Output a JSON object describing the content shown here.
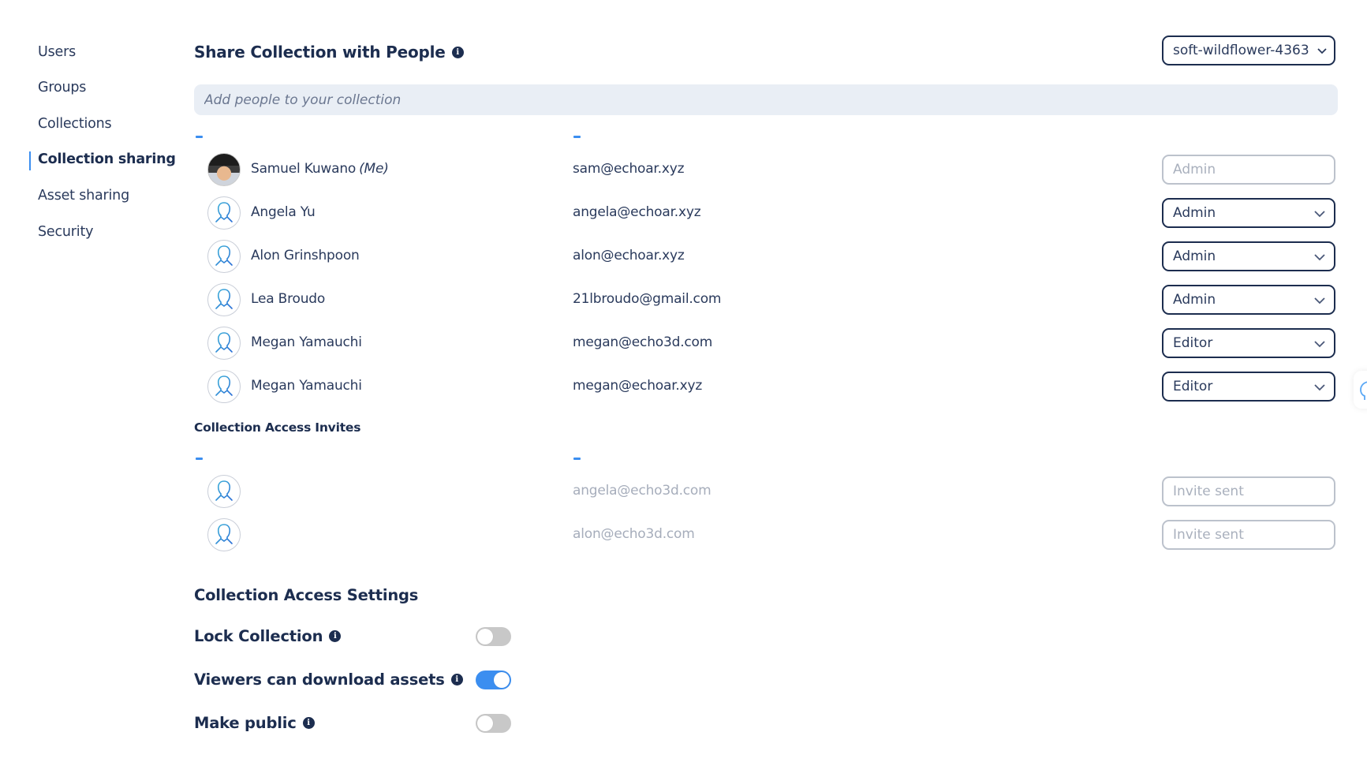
{
  "sidebar": {
    "items": [
      {
        "label": "Users",
        "active": false
      },
      {
        "label": "Groups",
        "active": false
      },
      {
        "label": "Collections",
        "active": false
      },
      {
        "label": "Collection sharing",
        "active": true
      },
      {
        "label": "Asset sharing",
        "active": false
      },
      {
        "label": "Security",
        "active": false
      }
    ],
    "accent_color": "#3b8ef0"
  },
  "share": {
    "title": "Share Collection with People",
    "collection_select": {
      "value": "soft-wildflower-4363"
    },
    "search": {
      "placeholder": "Add people to your collection",
      "value": ""
    },
    "columns": [
      "–",
      "–"
    ],
    "members": [
      {
        "name": "Samuel Kuwano",
        "me_suffix": "(Me)",
        "email": "sam@echoar.xyz",
        "role": "Admin",
        "role_editable": false,
        "avatar": "photo"
      },
      {
        "name": "Angela Yu",
        "email": "angela@echoar.xyz",
        "role": "Admin",
        "role_editable": true,
        "avatar": "default-user-icon"
      },
      {
        "name": "Alon Grinshpoon",
        "email": "alon@echoar.xyz",
        "role": "Admin",
        "role_editable": true,
        "avatar": "default-user-icon"
      },
      {
        "name": "Lea Broudo",
        "email": "21lbroudo@gmail.com",
        "role": "Admin",
        "role_editable": true,
        "avatar": "default-user-icon"
      },
      {
        "name": "Megan Yamauchi",
        "email": "megan@echo3d.com",
        "role": "Editor",
        "role_editable": true,
        "avatar": "default-user-icon"
      },
      {
        "name": "Megan Yamauchi",
        "email": "megan@echoar.xyz",
        "role": "Editor",
        "role_editable": true,
        "avatar": "default-user-icon"
      }
    ]
  },
  "invites": {
    "title": "Collection Access Invites",
    "columns": [
      "–",
      "–"
    ],
    "items": [
      {
        "email": "angela@echo3d.com",
        "status": "Invite sent"
      },
      {
        "email": "alon@echo3d.com",
        "status": "Invite sent"
      }
    ]
  },
  "settings": {
    "title": "Collection Access Settings",
    "items": [
      {
        "label": "Lock Collection",
        "enabled": false
      },
      {
        "label": "Viewers can download assets",
        "enabled": true
      },
      {
        "label": "Make public",
        "enabled": false
      }
    ]
  }
}
